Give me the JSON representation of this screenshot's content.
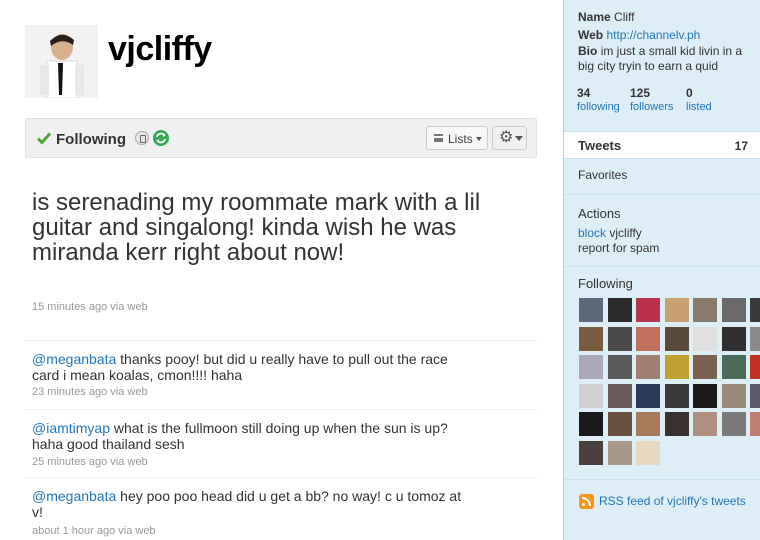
{
  "profile": {
    "screen_name": "vjcliffy"
  },
  "follow_bar": {
    "following_label": "Following",
    "lists_label": "Lists"
  },
  "latest_tweet": {
    "text": "is serenading my roommate mark with a lil guitar and singalong! kinda wish he was miranda kerr right about now!",
    "time": "15 minutes ago",
    "via": "via",
    "source": "web"
  },
  "timeline": [
    {
      "mention": "@meganbata",
      "text": " thanks pooy! but did u really have to pull out the race card i mean koalas, cmon!!!! haha",
      "time": "23 minutes ago",
      "via": "via",
      "source": "web"
    },
    {
      "mention": "@iamtimyap",
      "text": " what is the fullmoon still doing up when the sun is up? haha good thailand sesh",
      "time": "25 minutes ago",
      "via": "via",
      "source": "web"
    },
    {
      "mention": "@meganbata",
      "text": " hey poo poo head did u get a bb? no way! c u tomoz at v!",
      "time": "about 1 hour ago",
      "via": "via",
      "source": "web"
    }
  ],
  "sidebar": {
    "name_label": "Name",
    "name_value": "Cliff",
    "web_label": "Web",
    "web_value": "http://channelv.ph",
    "bio_label": "Bio",
    "bio_value": "im just a small kid livin in a big city tryin to earn a quid",
    "stats": [
      {
        "num": "34",
        "label": "following"
      },
      {
        "num": "125",
        "label": "followers"
      },
      {
        "num": "0",
        "label": "listed"
      }
    ],
    "tweets_label": "Tweets",
    "tweets_count": "17",
    "favorites_label": "Favorites",
    "actions_heading": "Actions",
    "block_label": "block",
    "block_user": "vjcliffy",
    "report_label": "report for spam",
    "following_heading": "Following",
    "rss_label": "RSS feed of vjcliffy's tweets"
  },
  "colors": {
    "link": "#2276bb",
    "sidebar_bg": "#ddeef6",
    "sidebar_border": "#a8d5ea",
    "check_green": "#4aa832"
  },
  "following_avatars": [
    "#5a6a7a",
    "#2a2a2a",
    "#b8324a",
    "#c9a070",
    "#8a7a6a",
    "#6a6a6a",
    "#3a3a3a",
    "#7a5a40",
    "#4a4a4a",
    "#c07060",
    "#5a4a3a",
    "#e0e0e0",
    "#303030",
    "#8a8a8a",
    "#aaa8b8",
    "#5a5a5a",
    "#a08070",
    "#c0a030",
    "#7a6050",
    "#4a6a5a",
    "#c03020",
    "#d0d0d0",
    "#6a5a5a",
    "#2a3a5a",
    "#3a3a3a",
    "#1a1a1a",
    "#9a8a7a",
    "#5a5a6a",
    "#1a1a1a",
    "#6a5040",
    "#aa7a5a",
    "#3a3030",
    "#b09080",
    "#7a7a7a",
    "#c08070",
    "#4a4040",
    "#a89888",
    "#e8d8c0"
  ]
}
